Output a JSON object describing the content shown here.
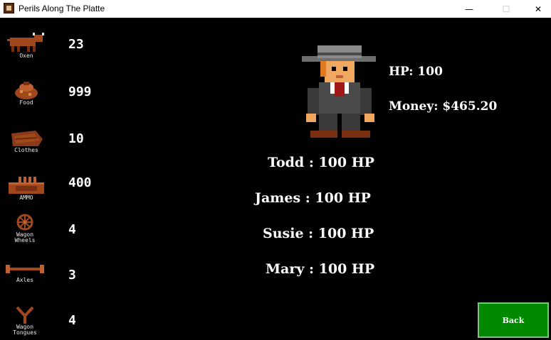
{
  "window": {
    "title": "Perils Along The Platte",
    "minimize_glyph": "—",
    "maximize_glyph": "☐",
    "close_glyph": "✕"
  },
  "inventory": [
    {
      "icon": "ox-icon",
      "label": "Oxen",
      "value": "23"
    },
    {
      "icon": "food-sack-icon",
      "label": "Food",
      "value": "999"
    },
    {
      "icon": "clothes-icon",
      "label": "Clothes",
      "value": "10"
    },
    {
      "icon": "ammo-crate-icon",
      "label": "AMMO",
      "value": "400"
    },
    {
      "icon": "wagon-wheel-icon",
      "label": "Wagon\nWheels",
      "value": "4"
    },
    {
      "icon": "axle-icon",
      "label": "Axles",
      "value": "3"
    },
    {
      "icon": "wagon-tongue-icon",
      "label": "Wagon\nTongues",
      "value": "4"
    }
  ],
  "player": {
    "hp_text": "HP: 100",
    "money_text": "Money: $465.20"
  },
  "party": [
    {
      "name": "Todd",
      "status": "Todd : 100 HP"
    },
    {
      "name": "James",
      "status": "James : 100 HP"
    },
    {
      "name": "Susie",
      "status": "Susie : 100 HP"
    },
    {
      "name": "Mary",
      "status": "Mary : 100 HP"
    }
  ],
  "back_label": "Back",
  "colors": {
    "background": "#000000",
    "back_button": "#008800",
    "text": "#ffffff",
    "icon_brown": "#a0481c"
  }
}
